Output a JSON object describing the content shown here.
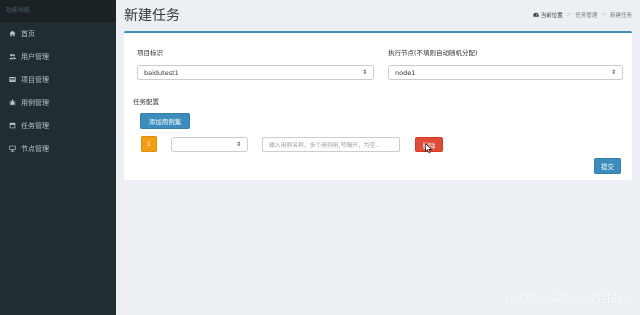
{
  "sidebar": {
    "header": "功能导航",
    "items": [
      {
        "label": "首页",
        "icon": "home-icon"
      },
      {
        "label": "用户管理",
        "icon": "users-icon"
      },
      {
        "label": "项目管理",
        "icon": "projects-icon"
      },
      {
        "label": "用例管理",
        "icon": "bug-icon"
      },
      {
        "label": "任务管理",
        "icon": "calendar-icon"
      },
      {
        "label": "节点管理",
        "icon": "desktop-icon"
      }
    ]
  },
  "header": {
    "title": "新建任务",
    "breadcrumb": [
      "当前位置",
      "任务管理",
      "新建任务"
    ]
  },
  "form": {
    "project_label": "项目标识",
    "project_value": "baidutest1",
    "node_label": "执行节点(不填则自动随机分配)",
    "node_value": "node1",
    "task_config_label": "任务配置",
    "add_case_set_button": "添加用例集",
    "row_index": "1",
    "case_set_select_value": "",
    "case_input_placeholder": "输入用例名称，多个用例用,号隔开，为空...",
    "delete_button": "删除",
    "submit_button": "提交"
  },
  "watermark": "CSDN @软件测试情报局",
  "colors": {
    "sidebar_bg": "#222d32",
    "primary": "#3c8dbc",
    "warning": "#f39c12",
    "danger": "#dd4b39"
  }
}
